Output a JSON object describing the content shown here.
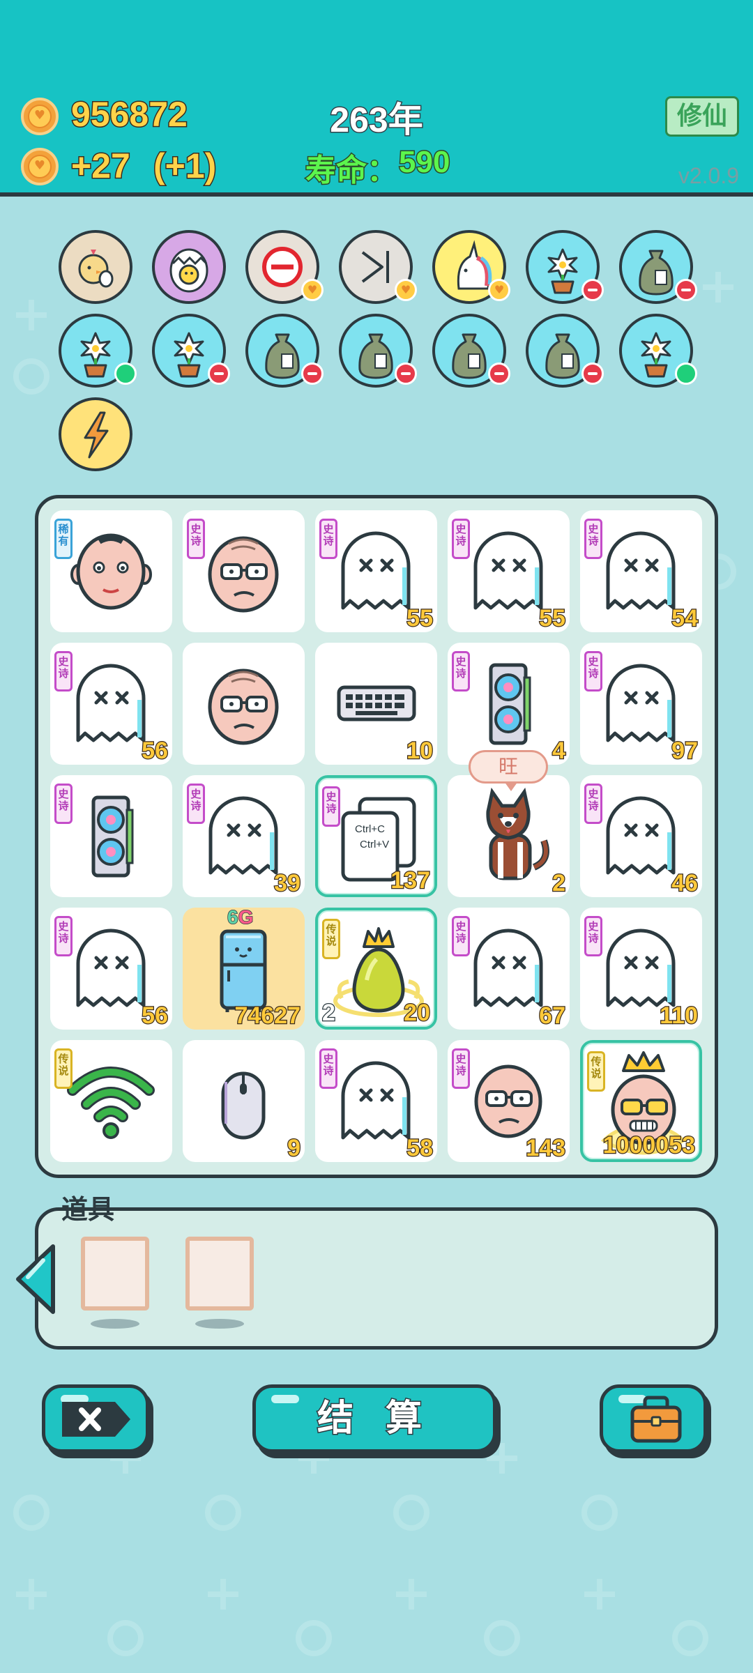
{
  "header": {
    "coins": "956872",
    "income": "+27",
    "income_bonus": "(+1)",
    "year": "263年",
    "lifespan_label": "寿命：",
    "lifespan_value": "590",
    "xiuxian_button": "修仙",
    "version": "v2.0.9"
  },
  "buffs": [
    {
      "icon": "chick-egg-icon",
      "bg": "#ecdcc2",
      "badge": null
    },
    {
      "icon": "cracked-egg-icon",
      "bg": "#d7a8e6",
      "badge": null
    },
    {
      "icon": "forbidden-icon",
      "bg": "#e8e1d8",
      "badge": "heart"
    },
    {
      "icon": "skip-end-icon",
      "bg": "#e4e1dc",
      "badge": "heart"
    },
    {
      "icon": "unicorn-icon",
      "bg": "#fff07a",
      "badge": "heart"
    },
    {
      "icon": "flower-pot-icon",
      "bg": "#7fe2ef",
      "badge": "minus"
    },
    {
      "icon": "sack-icon",
      "bg": "#7fe2ef",
      "badge": "minus"
    },
    {
      "icon": "flower-pot-icon",
      "bg": "#7fe2ef",
      "badge": "plus"
    },
    {
      "icon": "flower-pot-icon",
      "bg": "#7fe2ef",
      "badge": "minus"
    },
    {
      "icon": "sack-icon",
      "bg": "#7fe2ef",
      "badge": "minus"
    },
    {
      "icon": "sack-icon",
      "bg": "#7fe2ef",
      "badge": "minus"
    },
    {
      "icon": "sack-icon",
      "bg": "#7fe2ef",
      "badge": "minus"
    },
    {
      "icon": "sack-icon",
      "bg": "#7fe2ef",
      "badge": "minus"
    },
    {
      "icon": "flower-pot-icon",
      "bg": "#7fe2ef",
      "badge": "plus"
    },
    {
      "icon": "lightning-icon",
      "bg": "#ffe27a",
      "badge": null
    }
  ],
  "grid": [
    {
      "item": "bald-man",
      "tag": "稀有",
      "tag_type": "rare",
      "value": ""
    },
    {
      "item": "old-man-glasses",
      "tag": "史诗",
      "tag_type": "epic",
      "value": ""
    },
    {
      "item": "ghost",
      "tag": "史诗",
      "tag_type": "epic",
      "value": "55"
    },
    {
      "item": "ghost",
      "tag": "史诗",
      "tag_type": "epic",
      "value": "55"
    },
    {
      "item": "ghost",
      "tag": "史诗",
      "tag_type": "epic",
      "value": "54"
    },
    {
      "item": "ghost",
      "tag": "史诗",
      "tag_type": "epic",
      "value": "56"
    },
    {
      "item": "old-man-glasses",
      "tag": "",
      "tag_type": "",
      "value": ""
    },
    {
      "item": "keyboard",
      "tag": "",
      "tag_type": "",
      "value": "10"
    },
    {
      "item": "graphics-card",
      "tag": "史诗",
      "tag_type": "epic",
      "value": "4"
    },
    {
      "item": "ghost",
      "tag": "史诗",
      "tag_type": "epic",
      "value": "97"
    },
    {
      "item": "graphics-card",
      "tag": "史诗",
      "tag_type": "epic",
      "value": ""
    },
    {
      "item": "ghost",
      "tag": "史诗",
      "tag_type": "epic",
      "value": "39"
    },
    {
      "item": "copy-paste",
      "tag": "史诗",
      "tag_type": "epic",
      "value": "137",
      "highlight": true,
      "text1": "Ctrl+C",
      "text2": "Ctrl+V"
    },
    {
      "item": "husky-dog",
      "tag": "",
      "tag_type": "",
      "value": "2",
      "speech": "旺"
    },
    {
      "item": "ghost",
      "tag": "史诗",
      "tag_type": "epic",
      "value": "46"
    },
    {
      "item": "ghost",
      "tag": "史诗",
      "tag_type": "epic",
      "value": "56"
    },
    {
      "item": "fridge",
      "tag": "",
      "tag_type": "",
      "value": "74627",
      "yellow": true,
      "label_a": "6",
      "label_b": "G"
    },
    {
      "item": "crowned-pear",
      "tag": "传说",
      "tag_type": "legend",
      "value": "20",
      "left_value": "2",
      "highlight": true
    },
    {
      "item": "ghost",
      "tag": "史诗",
      "tag_type": "epic",
      "value": "67"
    },
    {
      "item": "ghost",
      "tag": "史诗",
      "tag_type": "epic",
      "value": "110"
    },
    {
      "item": "wifi",
      "tag": "传说",
      "tag_type": "legend",
      "value": ""
    },
    {
      "item": "mouse",
      "tag": "",
      "tag_type": "",
      "value": "9"
    },
    {
      "item": "ghost",
      "tag": "史诗",
      "tag_type": "epic",
      "value": "58"
    },
    {
      "item": "bald-glasses-man",
      "tag": "史诗",
      "tag_type": "epic",
      "value": "143"
    },
    {
      "item": "king-old-man",
      "tag": "传说",
      "tag_type": "legend",
      "value": "1000053",
      "highlight": true
    }
  ],
  "items_panel": {
    "title": "道具",
    "slots": [
      "empty-frame",
      "empty-frame"
    ]
  },
  "buttons": {
    "delete_icon": "close-icon",
    "settle_label": "结 算",
    "bag_icon": "briefcase-icon"
  },
  "colors": {
    "header_bg": "#17c3c4",
    "body_bg": "#a9dfe3",
    "value_yellow": "#ffc93a",
    "epic_tag": "#c44cc9",
    "legend_tag": "#d9b424",
    "rare_tag": "#3aa3d8"
  }
}
